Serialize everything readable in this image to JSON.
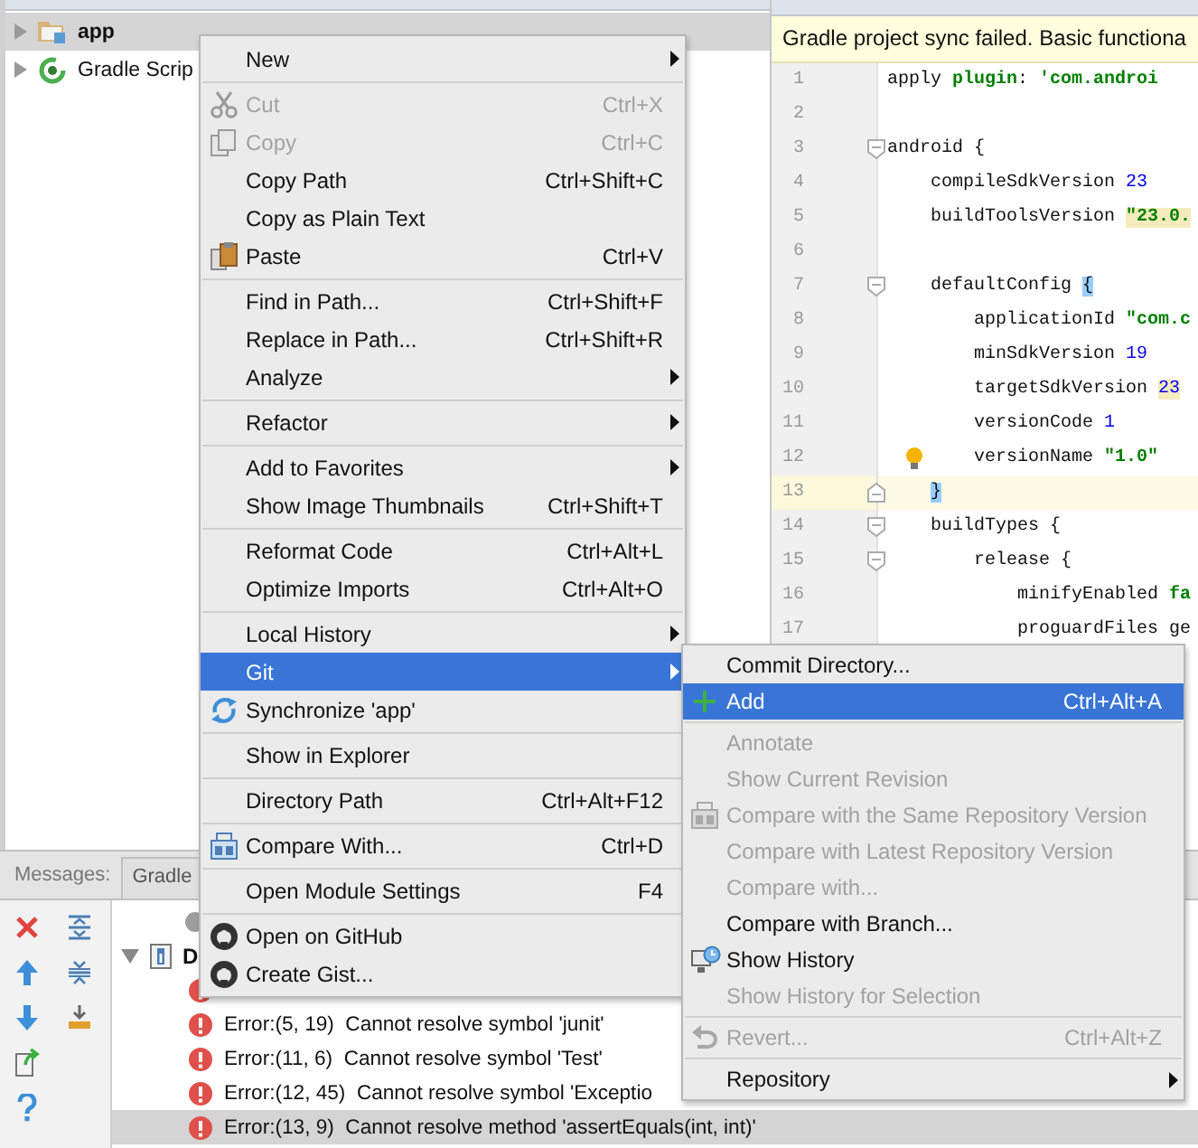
{
  "project_tree": [
    {
      "label": "app",
      "selected": true,
      "expanded": false
    },
    {
      "label": "Gradle Scrip",
      "selected": false,
      "expanded": false
    }
  ],
  "editor": {
    "banner": "Gradle project sync failed. Basic functiona",
    "lines": [
      {
        "number": "1",
        "current": false,
        "segments": [
          {
            "text": "apply ",
            "kind": "plain"
          },
          {
            "text": "plugin",
            "kind": "keyword"
          },
          {
            "text": ": ",
            "kind": "plain"
          },
          {
            "text": "'com.androi",
            "kind": "string"
          }
        ]
      },
      {
        "number": "2",
        "current": false
      },
      {
        "number": "3",
        "current": false,
        "fold_start": true,
        "segments": [
          {
            "text": "android {",
            "kind": "plain"
          }
        ]
      },
      {
        "number": "4",
        "current": false,
        "segments": [
          {
            "text": "    compileSdkVersion ",
            "kind": "plain"
          },
          {
            "text": "23",
            "kind": "number"
          }
        ]
      },
      {
        "number": "5",
        "current": false,
        "segments": [
          {
            "text": "    buildToolsVersion ",
            "kind": "plain"
          },
          {
            "text": "\"23.0.",
            "kind": "string-warning"
          }
        ]
      },
      {
        "number": "6",
        "current": false
      },
      {
        "number": "7",
        "current": false,
        "fold_start": true,
        "segments": [
          {
            "text": "    defaultConfig ",
            "kind": "plain"
          },
          {
            "text": "{",
            "kind": "brace-match"
          }
        ]
      },
      {
        "number": "8",
        "current": false,
        "segments": [
          {
            "text": "        applicationId ",
            "kind": "plain"
          },
          {
            "text": "\"com.c",
            "kind": "string"
          }
        ]
      },
      {
        "number": "9",
        "current": false,
        "segments": [
          {
            "text": "        minSdkVersion ",
            "kind": "plain"
          },
          {
            "text": "19",
            "kind": "number"
          }
        ]
      },
      {
        "number": "10",
        "current": false,
        "segments": [
          {
            "text": "        targetSdkVersion ",
            "kind": "plain"
          },
          {
            "text": "23",
            "kind": "number-warning"
          }
        ]
      },
      {
        "number": "11",
        "current": false,
        "segments": [
          {
            "text": "        versionCode ",
            "kind": "plain"
          },
          {
            "text": "1",
            "kind": "number"
          }
        ]
      },
      {
        "number": "12",
        "current": false,
        "bulb": true,
        "segments": [
          {
            "text": "        versionName ",
            "kind": "plain"
          },
          {
            "text": "\"1.0\"",
            "kind": "string"
          }
        ]
      },
      {
        "number": "13",
        "current": true,
        "fold_end": true,
        "segments": [
          {
            "text": "    }",
            "kind": "brace-match"
          }
        ]
      },
      {
        "number": "14",
        "current": false,
        "fold_start": true,
        "segments": [
          {
            "text": "    buildTypes {",
            "kind": "plain"
          }
        ]
      },
      {
        "number": "15",
        "current": false,
        "fold_start": true,
        "segments": [
          {
            "text": "        release {",
            "kind": "plain"
          }
        ]
      },
      {
        "number": "16",
        "current": false,
        "segments": [
          {
            "text": "            minifyEnabled ",
            "kind": "plain"
          },
          {
            "text": "fa",
            "kind": "keyword"
          }
        ]
      },
      {
        "number": "17",
        "current": false,
        "segments": [
          {
            "text": "            proguardFiles ge",
            "kind": "plain"
          }
        ]
      }
    ]
  },
  "messages_panel": {
    "title": "Messages:",
    "tabs": [
      {
        "label": "Gradle",
        "selected": false
      }
    ],
    "rows": [
      {
        "kind": "status"
      },
      {
        "kind": "group",
        "label": "D",
        "expanded": true,
        "children": [
          {
            "kind": "error",
            "selected": false
          },
          {
            "kind": "error",
            "text": "Error:(5, 19)  Cannot resolve symbol 'junit'",
            "selected": false
          },
          {
            "kind": "error",
            "text": "Error:(11, 6)  Cannot resolve symbol 'Test'",
            "selected": false
          },
          {
            "kind": "error",
            "text": "Error:(12, 45)  Cannot resolve symbol 'Exceptio",
            "selected": false
          },
          {
            "kind": "error",
            "text": "Error:(13, 9)  Cannot resolve method 'assertEquals(int, int)'",
            "selected": true
          }
        ]
      }
    ]
  },
  "context_menu": {
    "items": [
      {
        "kind": "item",
        "label": "New",
        "submenu": true,
        "disabled": false,
        "selected": false
      },
      {
        "kind": "separator"
      },
      {
        "kind": "item",
        "label": "Cut",
        "shortcut": "Ctrl+X",
        "submenu": false,
        "disabled": true,
        "selected": false
      },
      {
        "kind": "item",
        "label": "Copy",
        "shortcut": "Ctrl+C",
        "submenu": false,
        "disabled": true,
        "selected": false
      },
      {
        "kind": "item",
        "label": "Copy Path",
        "shortcut": "Ctrl+Shift+C",
        "submenu": false,
        "disabled": false,
        "selected": false
      },
      {
        "kind": "item",
        "label": "Copy as Plain Text",
        "submenu": false,
        "disabled": false,
        "selected": false
      },
      {
        "kind": "item",
        "label": "Paste",
        "shortcut": "Ctrl+V",
        "submenu": false,
        "disabled": false,
        "selected": false
      },
      {
        "kind": "separator"
      },
      {
        "kind": "item",
        "label": "Find in Path...",
        "shortcut": "Ctrl+Shift+F",
        "submenu": false,
        "disabled": false,
        "selected": false
      },
      {
        "kind": "item",
        "label": "Replace in Path...",
        "shortcut": "Ctrl+Shift+R",
        "submenu": false,
        "disabled": false,
        "selected": false
      },
      {
        "kind": "item",
        "label": "Analyze",
        "submenu": true,
        "disabled": false,
        "selected": false
      },
      {
        "kind": "separator"
      },
      {
        "kind": "item",
        "label": "Refactor",
        "submenu": true,
        "disabled": false,
        "selected": false
      },
      {
        "kind": "separator"
      },
      {
        "kind": "item",
        "label": "Add to Favorites",
        "submenu": true,
        "disabled": false,
        "selected": false
      },
      {
        "kind": "item",
        "label": "Show Image Thumbnails",
        "shortcut": "Ctrl+Shift+T",
        "submenu": false,
        "disabled": false,
        "selected": false
      },
      {
        "kind": "separator"
      },
      {
        "kind": "item",
        "label": "Reformat Code",
        "shortcut": "Ctrl+Alt+L",
        "submenu": false,
        "disabled": false,
        "selected": false
      },
      {
        "kind": "item",
        "label": "Optimize Imports",
        "shortcut": "Ctrl+Alt+O",
        "submenu": false,
        "disabled": false,
        "selected": false
      },
      {
        "kind": "separator"
      },
      {
        "kind": "item",
        "label": "Local History",
        "submenu": true,
        "disabled": false,
        "selected": false
      },
      {
        "kind": "item",
        "label": "Git",
        "submenu": true,
        "disabled": false,
        "selected": true
      },
      {
        "kind": "item",
        "label": "Synchronize 'app'",
        "submenu": false,
        "disabled": false,
        "selected": false
      },
      {
        "kind": "separator"
      },
      {
        "kind": "item",
        "label": "Show in Explorer",
        "submenu": false,
        "disabled": false,
        "selected": false
      },
      {
        "kind": "separator"
      },
      {
        "kind": "item",
        "label": "Directory Path",
        "shortcut": "Ctrl+Alt+F12",
        "submenu": false,
        "disabled": false,
        "selected": false
      },
      {
        "kind": "separator"
      },
      {
        "kind": "item",
        "label": "Compare With...",
        "shortcut": "Ctrl+D",
        "submenu": false,
        "disabled": false,
        "selected": false
      },
      {
        "kind": "separator"
      },
      {
        "kind": "item",
        "label": "Open Module Settings",
        "shortcut": "F4",
        "submenu": false,
        "disabled": false,
        "selected": false
      },
      {
        "kind": "separator"
      },
      {
        "kind": "item",
        "label": "Open on GitHub",
        "submenu": false,
        "disabled": false,
        "selected": false
      },
      {
        "kind": "item",
        "label": "Create Gist...",
        "submenu": false,
        "disabled": false,
        "selected": false
      }
    ]
  },
  "git_submenu": {
    "items": [
      {
        "kind": "item",
        "label": "Commit Directory...",
        "submenu": false,
        "disabled": false,
        "selected": false
      },
      {
        "kind": "item",
        "label": "Add",
        "shortcut": "Ctrl+Alt+A",
        "submenu": false,
        "disabled": false,
        "selected": true
      },
      {
        "kind": "separator"
      },
      {
        "kind": "item",
        "label": "Annotate",
        "submenu": false,
        "disabled": true,
        "selected": false
      },
      {
        "kind": "item",
        "label": "Show Current Revision",
        "submenu": false,
        "disabled": true,
        "selected": false
      },
      {
        "kind": "item",
        "label": "Compare with the Same Repository Version",
        "submenu": false,
        "disabled": true,
        "selected": false
      },
      {
        "kind": "item",
        "label": "Compare with Latest Repository Version",
        "submenu": false,
        "disabled": true,
        "selected": false
      },
      {
        "kind": "item",
        "label": "Compare with...",
        "submenu": false,
        "disabled": true,
        "selected": false
      },
      {
        "kind": "item",
        "label": "Compare with Branch...",
        "submenu": false,
        "disabled": false,
        "selected": false
      },
      {
        "kind": "item",
        "label": "Show History",
        "submenu": false,
        "disabled": false,
        "selected": false
      },
      {
        "kind": "item",
        "label": "Show History for Selection",
        "submenu": false,
        "disabled": true,
        "selected": false
      },
      {
        "kind": "separator"
      },
      {
        "kind": "item",
        "label": "Revert...",
        "shortcut": "Ctrl+Alt+Z",
        "submenu": false,
        "disabled": true,
        "selected": false
      },
      {
        "kind": "separator"
      },
      {
        "kind": "item",
        "label": "Repository",
        "submenu": true,
        "disabled": false,
        "selected": false
      }
    ]
  }
}
